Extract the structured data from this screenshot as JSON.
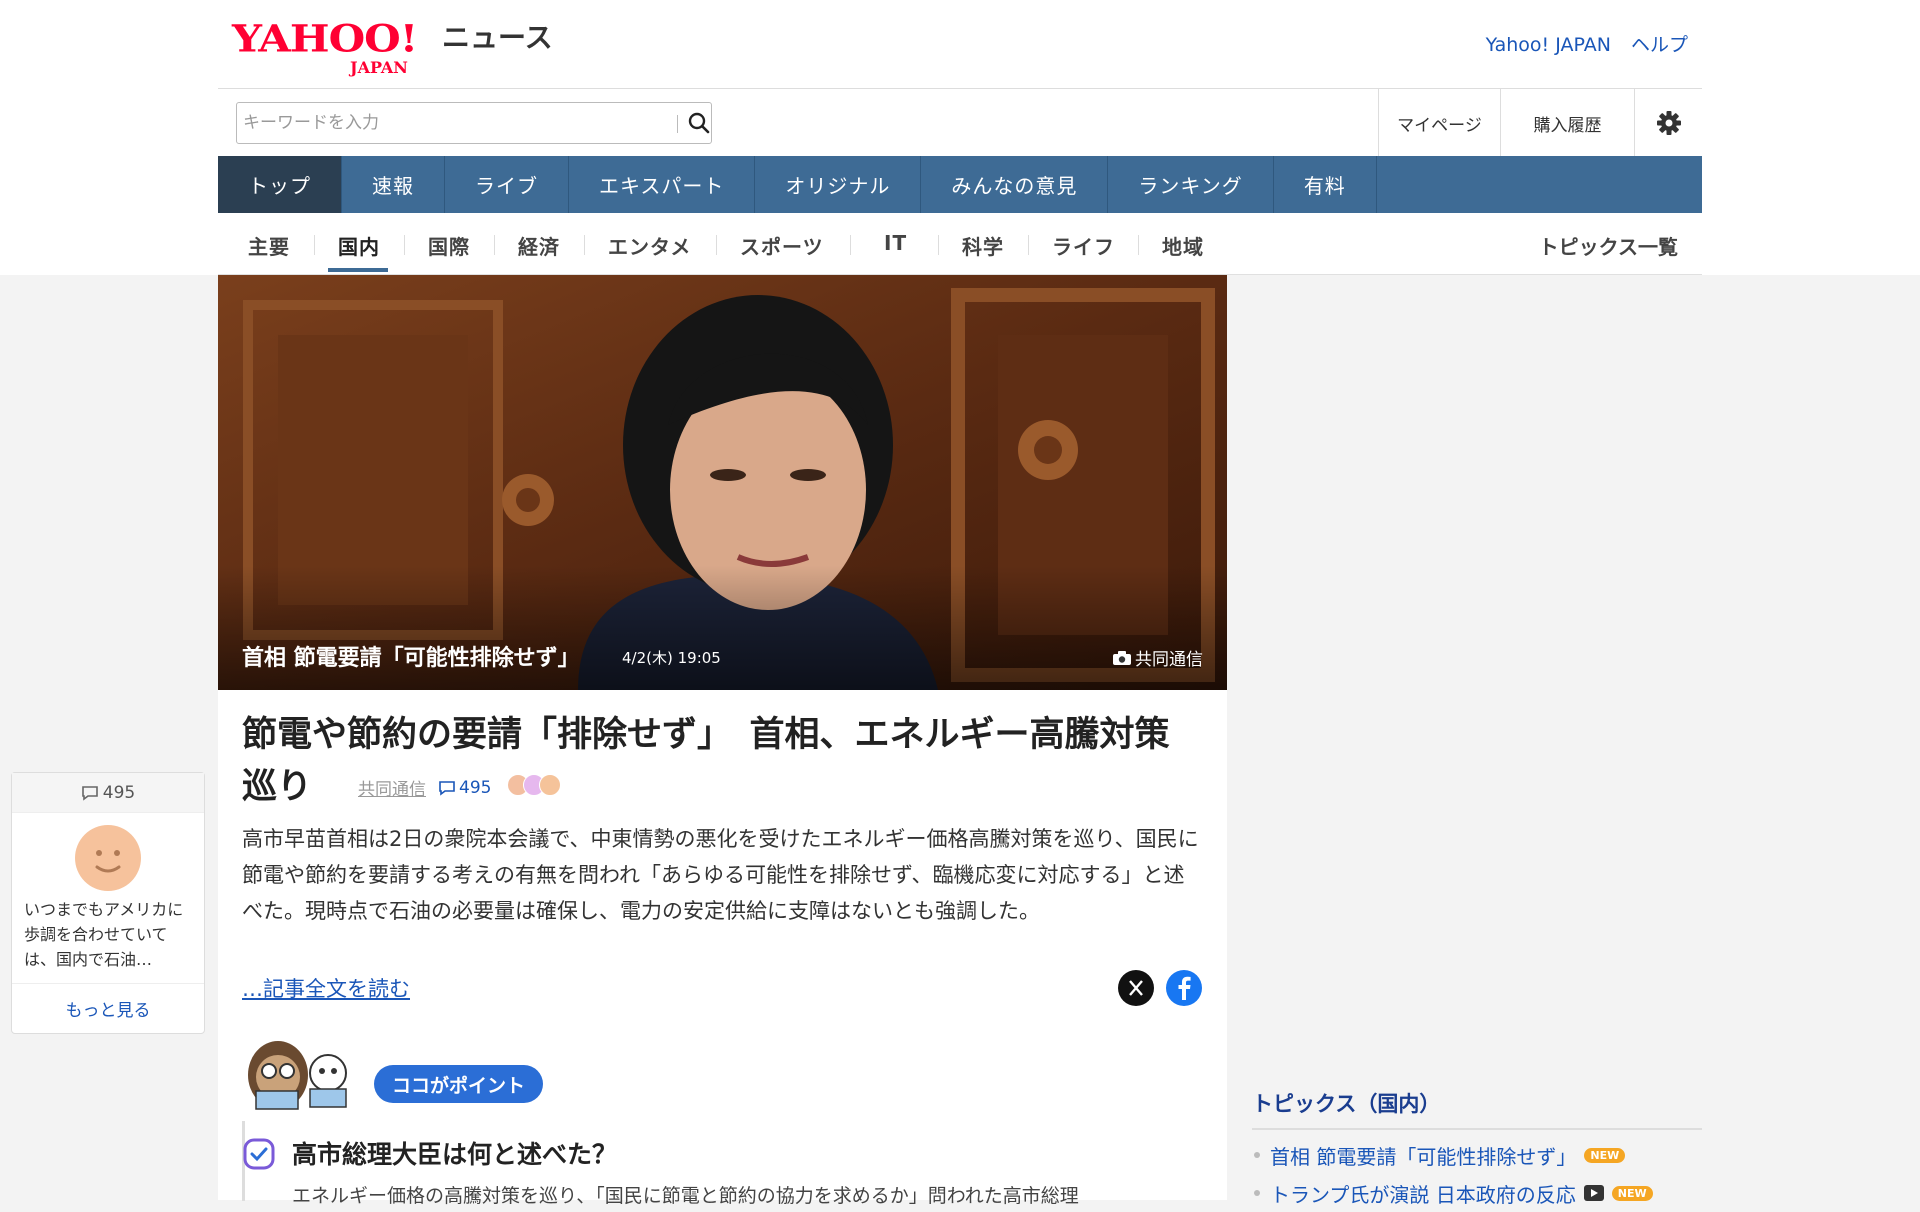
{
  "header": {
    "logo_text": "YAHOO!",
    "logo_sub": "JAPAN",
    "service_name": "ニュース",
    "top_links": [
      "Yahoo! JAPAN",
      "ヘルプ"
    ]
  },
  "search": {
    "placeholder": "キーワードを入力",
    "value": ""
  },
  "utility": {
    "mypage": "マイページ",
    "history": "購入履歴",
    "settings_icon": "gear-icon"
  },
  "main_nav": [
    "トップ",
    "速報",
    "ライブ",
    "エキスパート",
    "オリジナル",
    "みんなの意見",
    "ランキング",
    "有料"
  ],
  "category_nav": [
    "主要",
    "国内",
    "国際",
    "経済",
    "エンタメ",
    "スポーツ",
    "IT",
    "科学",
    "ライフ",
    "地域"
  ],
  "active_category": "国内",
  "topics_all": "トピックス一覧",
  "hero": {
    "caption": "首相 節電要請「可能性排除せず」",
    "time": "4/2(木) 19:05",
    "credit": "共同通信"
  },
  "article": {
    "headline": "節電や節約の要請「排除せず」　首相、エネルギー高騰対策巡り",
    "source": "共同通信",
    "comment_count": "495",
    "summary": "高市早苗首相は2日の衆院本会議で、中東情勢の悪化を受けたエネルギー価格高騰対策を巡り、国民に節電や節約を要請する考えの有無を問われ「あらゆる可能性を排除せず、臨機応変に対応する」と述べた。現時点で石油の必要量は確保し、電力の安定供給に支障はないとも強調した。",
    "read_more": "…記事全文を読む"
  },
  "point": {
    "badge": "ココがポイント",
    "question": "高市総理大臣は何と述べた？",
    "answer": "エネルギー価格の高騰対策を巡り、「国民に節電と節約の協力を求めるか」問われた高市総理"
  },
  "comment_widget": {
    "count": "495",
    "text": "いつまでもアメリカに歩調を合わせていては、国内で石油…",
    "more": "もっと見る"
  },
  "topics": {
    "title": "トピックス（国内）",
    "items": [
      {
        "label": "首相 節電要請「可能性排除せず」",
        "new": "NEW"
      },
      {
        "label": "トランプ氏が演説 日本政府の反応",
        "new": "NEW"
      }
    ]
  },
  "colors": {
    "nav_blue": "#3e6b95",
    "nav_active": "#2b3f52",
    "link": "#1a56b8",
    "brand_red": "#ff0033"
  }
}
